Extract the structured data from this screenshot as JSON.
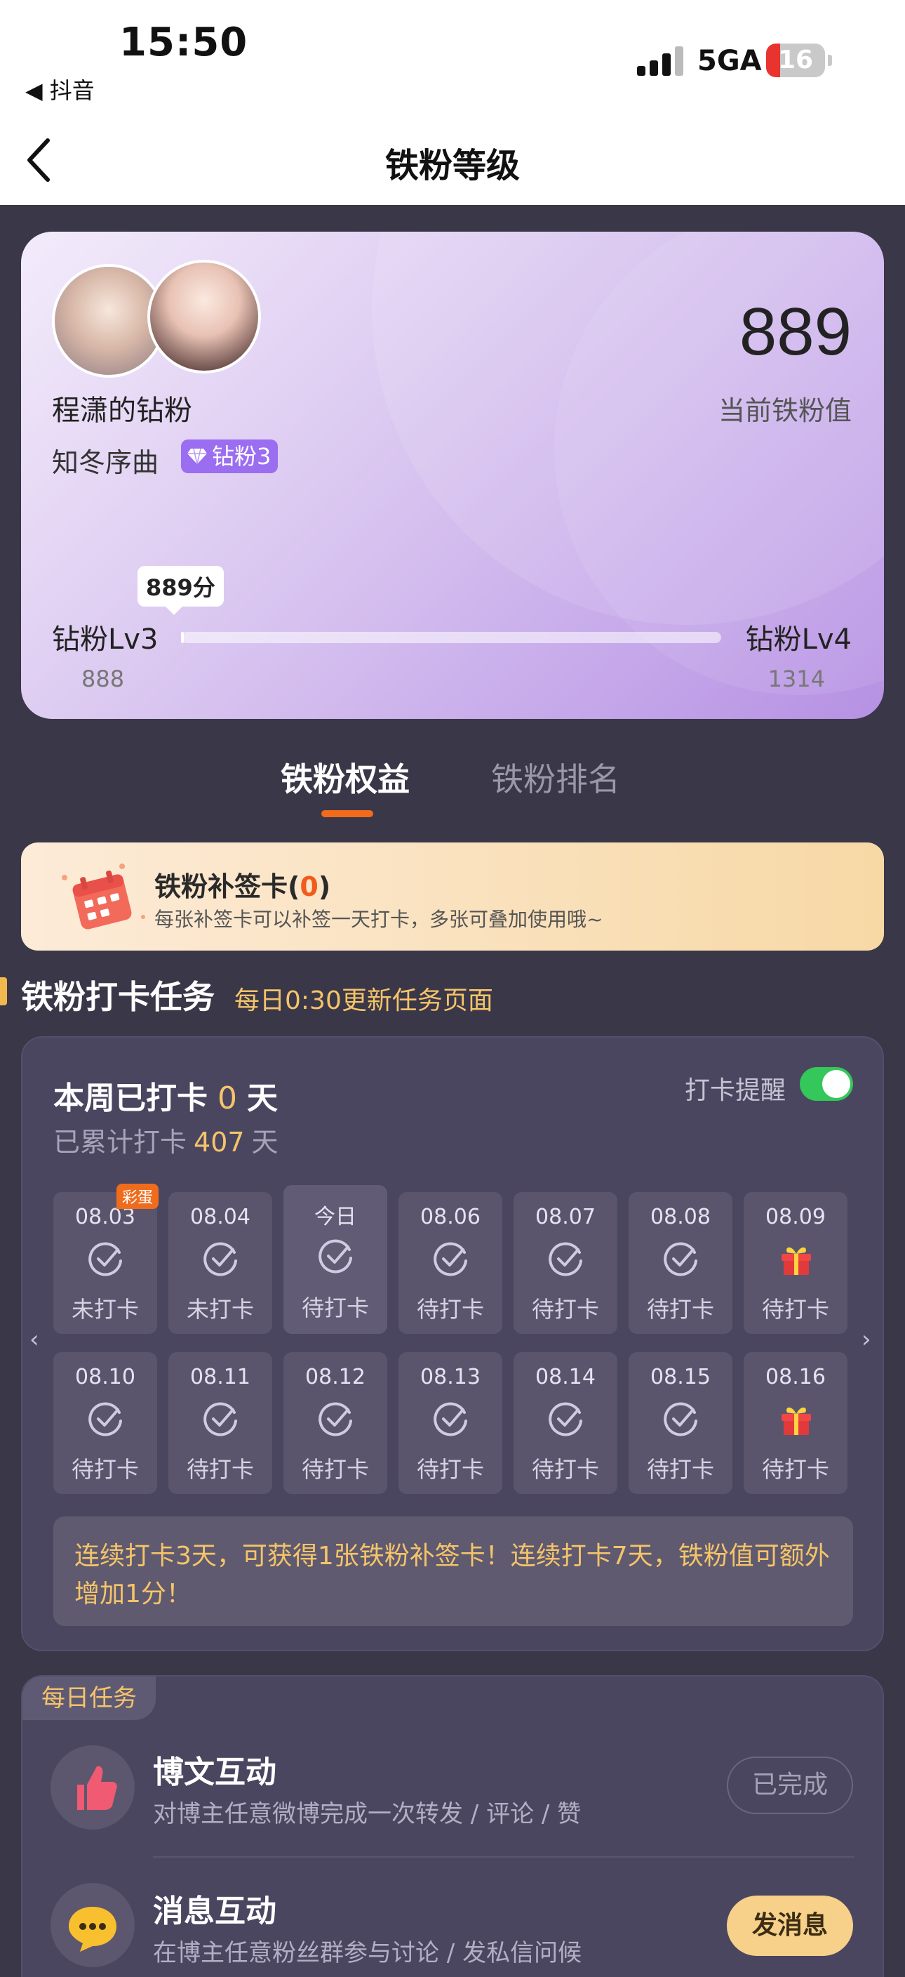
{
  "status_bar": {
    "time": "15:50",
    "back_app": "◀ 抖音",
    "network": "5GA",
    "battery": "16"
  },
  "nav": {
    "title": "铁粉等级"
  },
  "header_card": {
    "fan_name": "程潇的钻粉",
    "user_name": "知冬序曲",
    "badge": "钻粉3",
    "score": "889",
    "score_label": "当前铁粉值",
    "tooltip": "889分",
    "level_current": "钻粉Lv3",
    "level_next": "钻粉Lv4",
    "min_value": "888",
    "max_value": "1314",
    "progress_fraction": 0.0023
  },
  "tabs": [
    {
      "label": "铁粉权益",
      "active": true
    },
    {
      "label": "铁粉排名",
      "active": false
    }
  ],
  "buqian_card": {
    "title": "铁粉补签卡(",
    "count": "0",
    "title_end": ")",
    "desc": "每张补签卡可以补签一天打卡，多张可叠加使用哦~"
  },
  "section": {
    "title": "铁粉打卡任务",
    "subtitle": "每日0:30更新任务页面"
  },
  "checkin": {
    "week_prefix": "本周已打卡",
    "week_count": "0",
    "week_suffix": "天",
    "total_prefix": "已累计打卡",
    "total_count": "407",
    "total_suffix": "天",
    "remind_label": "打卡提醒",
    "remind_on": true,
    "egg_label": "彩蛋",
    "row1": [
      {
        "date": "08.03",
        "status": "未打卡",
        "icon": "check-circle-icon"
      },
      {
        "date": "08.04",
        "status": "未打卡",
        "icon": "check-circle-icon"
      },
      {
        "date": "今日",
        "status": "待打卡",
        "icon": "check-circle-icon"
      },
      {
        "date": "08.06",
        "status": "待打卡",
        "icon": "check-circle-icon"
      },
      {
        "date": "08.07",
        "status": "待打卡",
        "icon": "check-circle-icon"
      },
      {
        "date": "08.08",
        "status": "待打卡",
        "icon": "check-circle-icon"
      },
      {
        "date": "08.09",
        "status": "待打卡",
        "icon": "gift-icon"
      }
    ],
    "row2": [
      {
        "date": "08.10",
        "status": "待打卡",
        "icon": "check-circle-icon"
      },
      {
        "date": "08.11",
        "status": "待打卡",
        "icon": "check-circle-icon"
      },
      {
        "date": "08.12",
        "status": "待打卡",
        "icon": "check-circle-icon"
      },
      {
        "date": "08.13",
        "status": "待打卡",
        "icon": "check-circle-icon"
      },
      {
        "date": "08.14",
        "status": "待打卡",
        "icon": "check-circle-icon"
      },
      {
        "date": "08.15",
        "status": "待打卡",
        "icon": "check-circle-icon"
      },
      {
        "date": "08.16",
        "status": "待打卡",
        "icon": "gift-icon"
      }
    ],
    "note": "连续打卡3天，可获得1张铁粉补签卡！连续打卡7天，铁粉值可额外增加1分！"
  },
  "daily_tasks": {
    "tag": "每日任务",
    "tasks": [
      {
        "title": "博文互动",
        "desc": "对博主任意微博完成一次转发 / 评论 / 赞",
        "button": "已完成",
        "icon": "thumbs-up-icon"
      },
      {
        "title": "消息互动",
        "desc": "在博主任意粉丝群参与讨论 / 发私信问候",
        "button": "发消息",
        "icon": "chat-bubble-icon"
      }
    ]
  },
  "colors": {
    "background": "#3a3748",
    "accent_orange": "#f26a1b",
    "gold_text": "#f5c46a",
    "toggle_on": "#34c759",
    "badge_purple": "#9b6df0"
  }
}
